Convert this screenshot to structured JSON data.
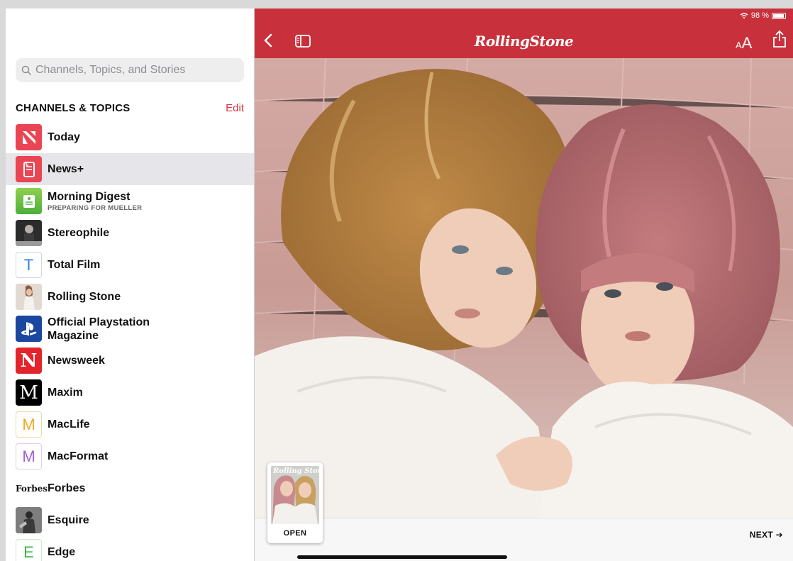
{
  "status_bar": {
    "battery": "98 %"
  },
  "search": {
    "placeholder": "Channels, Topics, and Stories"
  },
  "sidebar": {
    "section_title": "CHANNELS & TOPICS",
    "edit_label": "Edit",
    "items": [
      {
        "label": "Today",
        "icon": "apple-news-icon"
      },
      {
        "label": "News+",
        "icon": "news-plus-icon",
        "selected": true
      },
      {
        "label": "Morning Digest",
        "sublabel": "PREPARING FOR MUELLER",
        "icon": "morning-digest-icon"
      },
      {
        "label": "Stereophile",
        "icon": "stereophile-icon"
      },
      {
        "label": "Total Film",
        "icon": "total-film-icon",
        "letter": "T"
      },
      {
        "label": "Rolling Stone",
        "icon": "rolling-stone-thumb-icon"
      },
      {
        "label": "Official Playstation Magazine",
        "icon": "playstation-icon"
      },
      {
        "label": "Newsweek",
        "icon": "newsweek-icon",
        "letter": "N"
      },
      {
        "label": "Maxim",
        "icon": "maxim-icon",
        "letter": "M"
      },
      {
        "label": "MacLife",
        "icon": "maclife-icon",
        "letter": "M"
      },
      {
        "label": "MacFormat",
        "icon": "macformat-icon",
        "letter": "M"
      },
      {
        "label": "Forbes",
        "icon": "forbes-icon",
        "logo_text": "Forbes"
      },
      {
        "label": "Esquire",
        "icon": "esquire-icon"
      },
      {
        "label": "Edge",
        "icon": "edge-icon",
        "letter": "E"
      }
    ]
  },
  "reader": {
    "brand": "RollingStone",
    "accent_color": "#c8313b",
    "cover_logo": "Rolling Stone",
    "open_label": "OPEN",
    "next_label": "NEXT ➔"
  }
}
